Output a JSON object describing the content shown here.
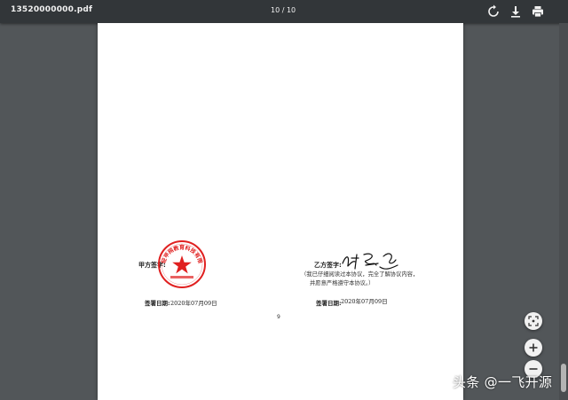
{
  "toolbar": {
    "filename": "13520000000.pdf",
    "page_indicator": "10 / 10",
    "rotate_icon": "rotate-icon",
    "download_icon": "download-icon",
    "print_icon": "print-icon"
  },
  "document": {
    "party_a_label": "甲方签字:",
    "party_a_seal_text": "北京轻甲网教育科技有限公司",
    "party_a_date_label": "签署日期:",
    "party_a_date_value": "2020年07月09日",
    "party_b_label": "乙方签字:",
    "party_b_note_line1": "（我已仔细阅读过本协议，完全了解协议内容，",
    "party_b_note_line2": "并愿意严格遵守本协议。）",
    "party_b_date_label": "签署日期:",
    "party_b_date_value": "2020年07月09日",
    "page_number": "9"
  },
  "zoom_controls": {
    "fit_icon": "fit-to-page-icon",
    "zoom_in_icon": "plus-icon",
    "zoom_out_icon": "minus-icon"
  },
  "watermark": "头条 @一飞开源",
  "colors": {
    "toolbar_bg": "#323639",
    "viewer_bg": "#525659",
    "stamp_red": "#e02020",
    "page_bg": "#ffffff"
  }
}
